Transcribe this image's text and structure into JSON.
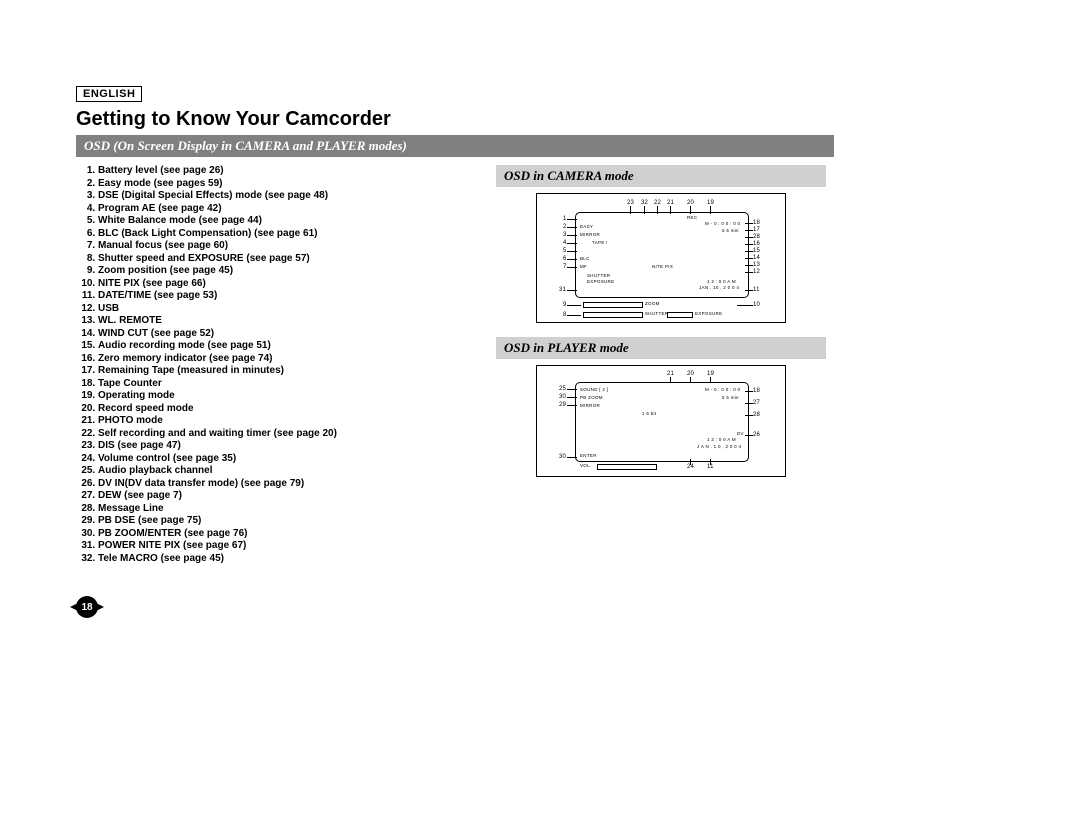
{
  "language": "ENGLISH",
  "title": "Getting to Know Your Camcorder",
  "subtitle": "OSD (On Screen Display in CAMERA and PLAYER modes)",
  "page_number": "18",
  "osd_items": [
    "Battery level (see page 26)",
    "Easy mode (see pages 59)",
    "DSE (Digital Special Effects) mode (see page 48)",
    "Program AE (see page 42)",
    "White Balance mode (see page 44)",
    "BLC (Back Light Compensation) (see page 61)",
    "Manual focus (see page 60)",
    "Shutter speed and EXPOSURE (see page 57)",
    "Zoom position (see page 45)",
    "NITE PIX (see page 66)",
    "DATE/TIME (see page 53)",
    "USB",
    "WL. REMOTE",
    "WIND CUT (see page 52)",
    "Audio recording mode (see page 51)",
    "Zero memory indicator (see page 74)",
    "Remaining Tape (measured in minutes)",
    "Tape Counter",
    "Operating mode",
    "Record speed mode",
    "PHOTO mode",
    "Self recording and and waiting timer (see page 20)",
    "DIS (see page 47)",
    "Volume control (see page 35)",
    "Audio playback channel",
    "DV IN(DV data transfer mode) (see page 79)",
    "DEW (see page 7)",
    "Message Line",
    "PB DSE (see page 75)",
    "PB ZOOM/ENTER (see page 76)",
    "POWER NITE PIX (see page 67)",
    "Tele MACRO (see page 45)"
  ],
  "camera_heading": "OSD in CAMERA mode",
  "player_heading": "OSD in PLAYER mode",
  "cam_diagram": {
    "top_nums": [
      "23",
      "32",
      "22",
      "21",
      "20",
      "19"
    ],
    "left_nums": [
      "1",
      "2",
      "3",
      "4",
      "5",
      "6",
      "7",
      "31",
      "9",
      "8"
    ],
    "right_nums": [
      "18",
      "17",
      "28",
      "16",
      "15",
      "14",
      "13",
      "12",
      "11",
      "10"
    ],
    "inner_left": [
      "EASY",
      "MIRROR",
      "TAPE !",
      "BLC",
      "MF"
    ],
    "inner_top": [
      "REC",
      "M - 0 : 0 0 : 0 0",
      "5 5 min"
    ],
    "inner_mid": [
      "NITE PIX",
      "SHUTTER",
      "EXPOSURE",
      "1 2 : 0 0 A M",
      "JAN . 10 , 2 0 0 4"
    ],
    "bottom": [
      "ZOOM",
      "SHUTTER",
      "EXPOSURE"
    ]
  },
  "play_diagram": {
    "top_nums": [
      "21",
      "20",
      "19"
    ],
    "left_nums": [
      "25",
      "30",
      "29",
      "30"
    ],
    "right_nums": [
      "18",
      "27",
      "28",
      "26",
      "24",
      "11"
    ],
    "inner": [
      "SOUND [ 2 ]",
      "PB ZOOM",
      "MIRROR",
      "M - 0 : 0 0 : 0 0",
      "5 5 min",
      "1 6 bit",
      "1 2 : 0 0 A M",
      "J A N . 1 0 , 2 0 0 4",
      "DV",
      "ENTER",
      "VOL."
    ]
  }
}
